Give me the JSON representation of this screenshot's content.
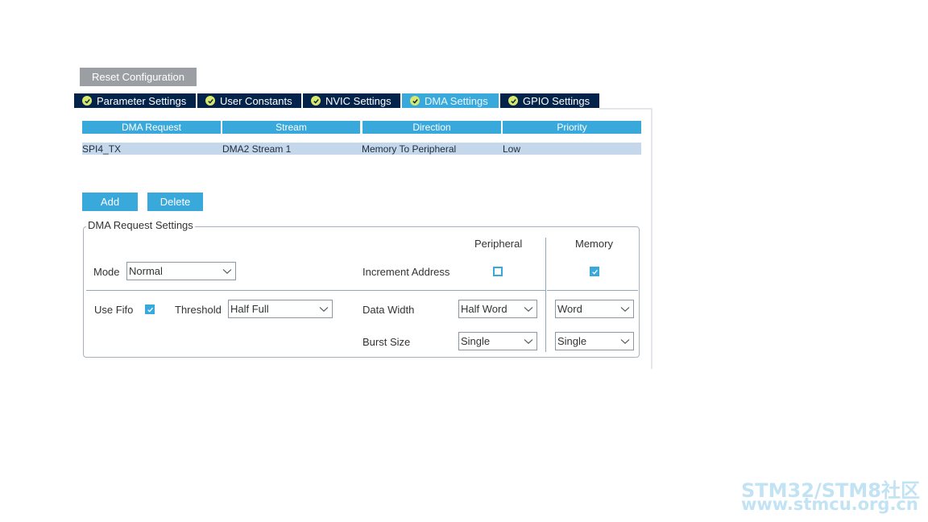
{
  "toolbar": {
    "reset_label": "Reset Configuration"
  },
  "tabs": [
    {
      "label": "Parameter Settings",
      "active": false
    },
    {
      "label": "User Constants",
      "active": false
    },
    {
      "label": "NVIC Settings",
      "active": false
    },
    {
      "label": "DMA Settings",
      "active": true
    },
    {
      "label": "GPIO Settings",
      "active": false
    }
  ],
  "table": {
    "headers": [
      "DMA Request",
      "Stream",
      "Direction",
      "Priority"
    ],
    "rows": [
      [
        "SPI4_TX",
        "DMA2 Stream 1",
        "Memory To Peripheral",
        "Low"
      ]
    ]
  },
  "actions": {
    "add_label": "Add",
    "delete_label": "Delete"
  },
  "settings": {
    "group_title": "DMA Request Settings",
    "peripheral_header": "Peripheral",
    "memory_header": "Memory",
    "mode_label": "Mode",
    "mode_value": "Normal",
    "increment_label": "Increment Address",
    "increment_peripheral": false,
    "increment_memory": true,
    "use_fifo_label": "Use Fifo",
    "use_fifo": true,
    "threshold_label": "Threshold",
    "threshold_value": "Half Full",
    "data_width_label": "Data Width",
    "data_width_peripheral": "Half Word",
    "data_width_memory": "Word",
    "burst_label": "Burst Size",
    "burst_peripheral": "Single",
    "burst_memory": "Single"
  },
  "watermark": {
    "line1": "STM32/STM8社区",
    "line2": "www.stmcu.org.cn"
  },
  "colors": {
    "tab_dark": "#03234b",
    "accent": "#39a9dc",
    "row_selected": "#c5d7ea"
  }
}
